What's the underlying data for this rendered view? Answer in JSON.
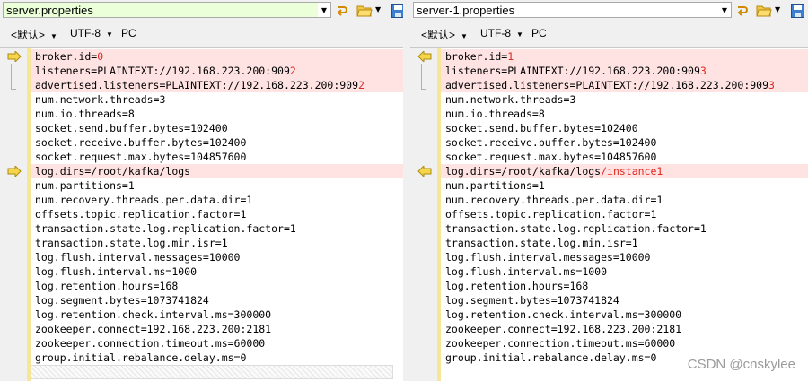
{
  "left": {
    "file_name": "server.properties",
    "status": {
      "encoding_default": "<默认>",
      "charset": "UTF-8",
      "line_endings": "PC"
    },
    "lines": [
      {
        "segments": [
          {
            "t": "broker.id="
          },
          {
            "t": "0",
            "d": true
          }
        ],
        "changed": true
      },
      {
        "segments": [
          {
            "t": "listeners=PLAINTEXT://192.168.223.200:909"
          },
          {
            "t": "2",
            "d": true
          }
        ],
        "changed": true
      },
      {
        "segments": [
          {
            "t": "advertised.listeners=PLAINTEXT://192.168.223.200:909"
          },
          {
            "t": "2",
            "d": true
          }
        ],
        "changed": true
      },
      {
        "segments": [
          {
            "t": "num.network.threads=3"
          }
        ]
      },
      {
        "segments": [
          {
            "t": "num.io.threads=8"
          }
        ]
      },
      {
        "segments": [
          {
            "t": "socket.send.buffer.bytes=102400"
          }
        ]
      },
      {
        "segments": [
          {
            "t": "socket.receive.buffer.bytes=102400"
          }
        ]
      },
      {
        "segments": [
          {
            "t": "socket.request.max.bytes=104857600"
          }
        ]
      },
      {
        "segments": [
          {
            "t": "log.dirs=/root/kafka/logs"
          }
        ],
        "changed": true
      },
      {
        "segments": [
          {
            "t": "num.partitions=1"
          }
        ]
      },
      {
        "segments": [
          {
            "t": "num.recovery.threads.per.data.dir=1"
          }
        ]
      },
      {
        "segments": [
          {
            "t": "offsets.topic.replication.factor=1"
          }
        ]
      },
      {
        "segments": [
          {
            "t": "transaction.state.log.replication.factor=1"
          }
        ]
      },
      {
        "segments": [
          {
            "t": "transaction.state.log.min.isr=1"
          }
        ]
      },
      {
        "segments": [
          {
            "t": "log.flush.interval.messages=10000"
          }
        ]
      },
      {
        "segments": [
          {
            "t": "log.flush.interval.ms=1000"
          }
        ]
      },
      {
        "segments": [
          {
            "t": "log.retention.hours=168"
          }
        ]
      },
      {
        "segments": [
          {
            "t": "log.segment.bytes=1073741824"
          }
        ]
      },
      {
        "segments": [
          {
            "t": "log.retention.check.interval.ms=300000"
          }
        ]
      },
      {
        "segments": [
          {
            "t": "zookeeper.connect=192.168.223.200:2181"
          }
        ]
      },
      {
        "segments": [
          {
            "t": "zookeeper.connection.timeout.ms=60000"
          }
        ]
      },
      {
        "segments": [
          {
            "t": "group.initial.rebalance.delay.ms=0"
          }
        ]
      }
    ]
  },
  "right": {
    "file_name": "server-1.properties",
    "status": {
      "encoding_default": "<默认>",
      "charset": "UTF-8",
      "line_endings": "PC"
    },
    "lines": [
      {
        "segments": [
          {
            "t": "broker.id="
          },
          {
            "t": "1",
            "d": true
          }
        ],
        "changed": true
      },
      {
        "segments": [
          {
            "t": "listeners=PLAINTEXT://192.168.223.200:909"
          },
          {
            "t": "3",
            "d": true
          }
        ],
        "changed": true
      },
      {
        "segments": [
          {
            "t": "advertised.listeners=PLAINTEXT://192.168.223.200:909"
          },
          {
            "t": "3",
            "d": true
          }
        ],
        "changed": true
      },
      {
        "segments": [
          {
            "t": "num.network.threads=3"
          }
        ]
      },
      {
        "segments": [
          {
            "t": "num.io.threads=8"
          }
        ]
      },
      {
        "segments": [
          {
            "t": "socket.send.buffer.bytes=102400"
          }
        ]
      },
      {
        "segments": [
          {
            "t": "socket.receive.buffer.bytes=102400"
          }
        ]
      },
      {
        "segments": [
          {
            "t": "socket.request.max.bytes=104857600"
          }
        ]
      },
      {
        "segments": [
          {
            "t": "log.dirs=/root/kafka/logs"
          },
          {
            "t": "/instance1",
            "d": true
          }
        ],
        "changed": true
      },
      {
        "segments": [
          {
            "t": "num.partitions=1"
          }
        ]
      },
      {
        "segments": [
          {
            "t": "num.recovery.threads.per.data.dir=1"
          }
        ]
      },
      {
        "segments": [
          {
            "t": "offsets.topic.replication.factor=1"
          }
        ]
      },
      {
        "segments": [
          {
            "t": "transaction.state.log.replication.factor=1"
          }
        ]
      },
      {
        "segments": [
          {
            "t": "transaction.state.log.min.isr=1"
          }
        ]
      },
      {
        "segments": [
          {
            "t": "log.flush.interval.messages=10000"
          }
        ]
      },
      {
        "segments": [
          {
            "t": "log.flush.interval.ms=1000"
          }
        ]
      },
      {
        "segments": [
          {
            "t": "log.retention.hours=168"
          }
        ]
      },
      {
        "segments": [
          {
            "t": "log.segment.bytes=1073741824"
          }
        ]
      },
      {
        "segments": [
          {
            "t": "log.retention.check.interval.ms=300000"
          }
        ]
      },
      {
        "segments": [
          {
            "t": "zookeeper.connect=192.168.223.200:2181"
          }
        ]
      },
      {
        "segments": [
          {
            "t": "zookeeper.connection.timeout.ms=60000"
          }
        ]
      },
      {
        "segments": [
          {
            "t": "group.initial.rebalance.delay.ms=0"
          }
        ]
      }
    ]
  },
  "watermark": "CSDN @cnskylee",
  "icons": {
    "open": "folder-open-icon",
    "save": "save-icon",
    "reload": "reload-icon",
    "diff_left": "arrow-right-icon",
    "diff_right": "arrow-left-icon"
  },
  "colors": {
    "diff_text": "#e0281e",
    "changed_bg": "#ffe3e3",
    "file_combo_left": "#ebffd9",
    "gutter_bar": "#f7e59a"
  }
}
